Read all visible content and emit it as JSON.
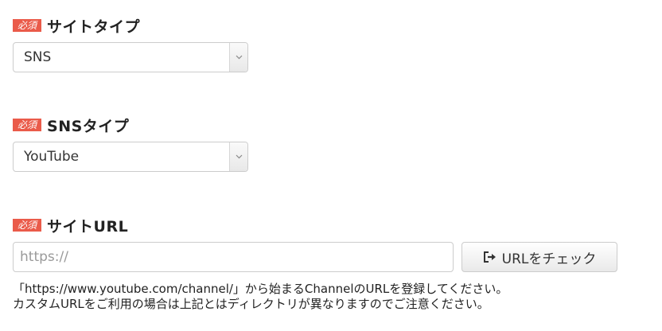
{
  "fields": {
    "site_type": {
      "required_badge": "必須",
      "label": "サイトタイプ",
      "selected": "SNS"
    },
    "sns_type": {
      "required_badge": "必須",
      "label": "SNSタイプ",
      "selected": "YouTube"
    },
    "site_url": {
      "required_badge": "必須",
      "label": "サイトURL",
      "value": "",
      "placeholder": "https://",
      "check_button_label": "URLをチェック",
      "check_button_icon": "exit-arrow-icon",
      "help_line_1": "「https://www.youtube.com/channel/」から始まるChannelのURLを登録してください。",
      "help_line_2": "カスタムURLをご利用の場合は上記とはディレクトリが異なりますのでご注意ください。"
    }
  },
  "colors": {
    "required_badge": "#ea5b4a",
    "border": "#cccccc",
    "text": "#333333"
  }
}
